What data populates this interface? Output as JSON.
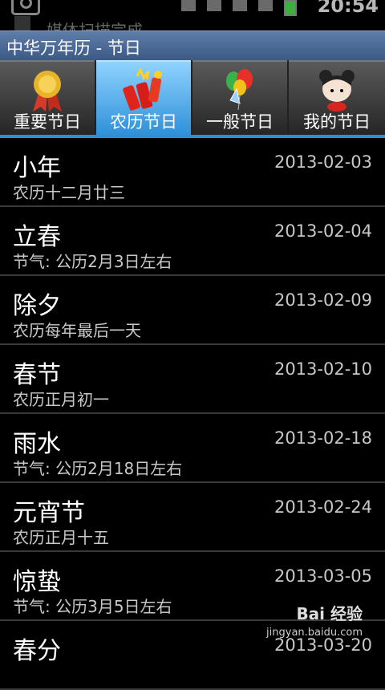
{
  "status_bar": {
    "notification_text": "媒体扫描完成",
    "time": "20:54"
  },
  "title_bar": {
    "title": "中华万年历 - 节日"
  },
  "tabs": [
    {
      "label": "重要节日",
      "icon": "medal-icon",
      "active": false
    },
    {
      "label": "农历节日",
      "icon": "firecracker-icon",
      "active": true
    },
    {
      "label": "一般节日",
      "icon": "balloons-icon",
      "active": false
    },
    {
      "label": "我的节日",
      "icon": "doll-icon",
      "active": false
    }
  ],
  "holidays": [
    {
      "name": "小年",
      "desc": "农历十二月廿三",
      "date": "2013-02-03"
    },
    {
      "name": "立春",
      "desc": "节气: 公历2月3日左右",
      "date": "2013-02-04"
    },
    {
      "name": "除夕",
      "desc": "农历每年最后一天",
      "date": "2013-02-09"
    },
    {
      "name": "春节",
      "desc": "农历正月初一",
      "date": "2013-02-10"
    },
    {
      "name": "雨水",
      "desc": "节气: 公历2月18日左右",
      "date": "2013-02-18"
    },
    {
      "name": "元宵节",
      "desc": "农历正月十五",
      "date": "2013-02-24"
    },
    {
      "name": "惊蛰",
      "desc": "节气: 公历3月5日左右",
      "date": "2013-03-05"
    },
    {
      "name": "春分",
      "desc": "",
      "date": "2013-03-20"
    }
  ],
  "watermark": {
    "brand": "Bai 经验",
    "url": "jingyan.baidu.com"
  }
}
